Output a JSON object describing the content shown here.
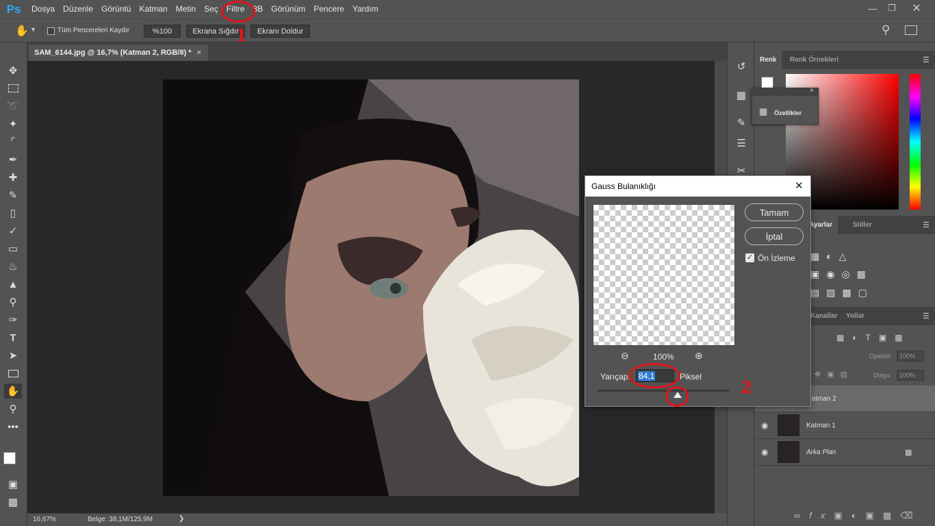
{
  "app": {
    "logo": "Ps"
  },
  "menu": [
    "Dosya",
    "Düzenle",
    "Görüntü",
    "Katman",
    "Metin",
    "Seç",
    "Filtre",
    "3B",
    "Görünüm",
    "Pencere",
    "Yardım"
  ],
  "options": {
    "scroll_all_label": "Tüm Pencereleri Kaydır",
    "zoom_btn": "%100",
    "fit_screen_btn": "Ekrana Sığdır",
    "fill_screen_btn": "Ekranı Doldur"
  },
  "document": {
    "tab_title": "SAM_6144.jpg @ 16,7% (Katman 2, RGB/8) *",
    "close_glyph": "×"
  },
  "status": {
    "zoom": "16,67%",
    "doc_size": "Belge: 38,1M/125,9M",
    "arrow": "❯"
  },
  "color_panel": {
    "tabs": [
      "Renk",
      "Renk Örnekleri"
    ]
  },
  "properties_panel": {
    "label": "Özellikler"
  },
  "adjustments_panel": {
    "tabs": [
      "Ayarlar",
      "Stiller"
    ]
  },
  "layers_panel": {
    "tabs": [
      "Kanallar",
      "Yollar"
    ],
    "opacity_label": "Opaklık:",
    "opacity_value": "100%",
    "fill_label": "Dolgu:",
    "fill_value": "100%",
    "layers": [
      {
        "name": "Katman 2",
        "visible": false,
        "selected": true
      },
      {
        "name": "Katman 1",
        "visible": true,
        "selected": false
      },
      {
        "name": "Arka Plan",
        "visible": true,
        "selected": false,
        "locked": true
      }
    ]
  },
  "dialog": {
    "title": "Gauss Bulanıklığı",
    "ok_label": "Tamam",
    "cancel_label": "İptal",
    "preview_label": "Ön İzleme",
    "preview_checked": true,
    "zoom_percent": "100%",
    "radius_label": "Yarıçap:",
    "radius_value": "84,1",
    "radius_unit": "Piksel",
    "slider_fraction": 0.6
  },
  "annotations": {
    "marker1": "1",
    "marker2": "2"
  },
  "colors": {
    "annotation_red": "#e1141b",
    "accent": "#31a8ff"
  }
}
